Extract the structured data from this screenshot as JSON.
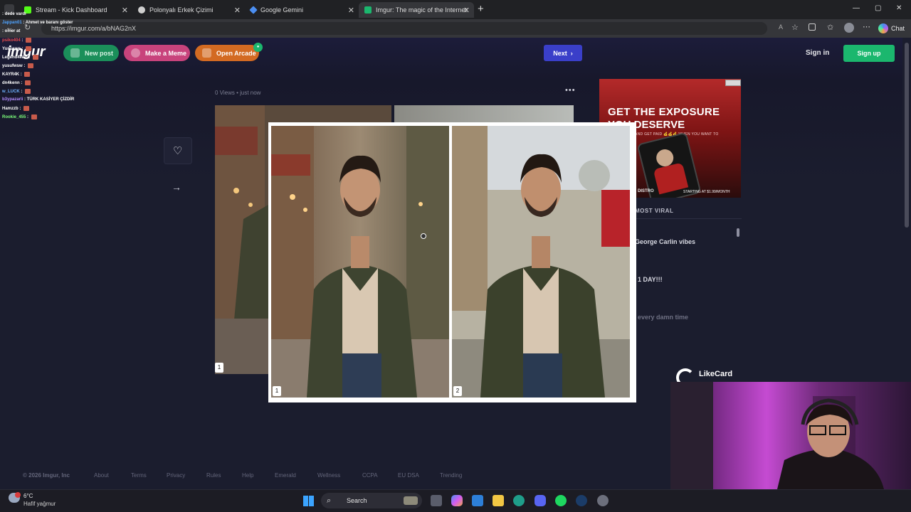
{
  "browser": {
    "tabs": [
      {
        "label": "Stream - Kick Dashboard",
        "icon_color": "#53fc18"
      },
      {
        "label": "Polonyalı Erkek Çizimi",
        "icon_color": "#cccccc"
      },
      {
        "label": "Google Gemini",
        "icon_color": "#4b8ef1"
      },
      {
        "label": "Imgur: The magic of the Internet",
        "icon_color": "#1bb76e"
      }
    ],
    "url": "https://imgur.com/a/bNAG2nX",
    "chat_button": "Chat"
  },
  "imgur": {
    "logo": "imgur",
    "new_post": "New post",
    "make_meme": "Make a Meme",
    "open_arcade": "Open Arcade",
    "next": "Next",
    "sign_in": "Sign in",
    "sign_up": "Sign up",
    "meta": "0 Views • just now",
    "more_menu": "•••",
    "like_icon": "♡",
    "share_icon": "→",
    "image_number": "1"
  },
  "ad": {
    "headline1": "GET THE EXPOSURE",
    "headline2": "YOU DESERVE",
    "sub": "AND GET PAID 💰💰💰 WHEN YOU WANT TO",
    "brand": "DISTRO",
    "price": "STARTING AT $1.99/MONTH"
  },
  "sidebar": {
    "title": "MOST VIRAL",
    "items": [
      "George Carlin vibes",
      "1 DAY!!!",
      "every damn time"
    ]
  },
  "lightbox": {
    "photos": [
      {
        "number": "1"
      },
      {
        "number": "2"
      }
    ]
  },
  "chat": [
    {
      "user": "",
      "msg": "dede vardı",
      "color": "#9b9b9b"
    },
    {
      "user": "Jappan01",
      "msg": "Ahmet ve baranı göster",
      "color": "#4ea3ff"
    },
    {
      "user": "",
      "msg": "omer at",
      "color": "#e06060"
    },
    {
      "user": "psiko404",
      "msg": "",
      "color": "#e84d4d"
    },
    {
      "user": "Yunuswe",
      "msg": "",
      "color": "#ffffff"
    },
    {
      "user": "Legend4Win",
      "msg": "",
      "color": "#ffffff"
    },
    {
      "user": "yusufwsw",
      "msg": "",
      "color": "#ffffff"
    },
    {
      "user": "KAYR4K",
      "msg": "",
      "color": "#ffffff"
    },
    {
      "user": "dn4kenn",
      "msg": "",
      "color": "#ffffff"
    },
    {
      "user": "w_LUCK",
      "msg": "",
      "color": "#6fb2ff"
    },
    {
      "user": "b3ypazarli",
      "msg": "TÜRK KASİYER ÇİZDİR",
      "color": "#b38cff"
    },
    {
      "user": "Hamzzb",
      "msg": "",
      "color": "#ffffff"
    },
    {
      "user": "Rookie_455",
      "msg": "",
      "color": "#7cff7c"
    }
  ],
  "footer": {
    "copyright": "© 2026 Imgur, Inc",
    "links": [
      "About",
      "Terms",
      "Privacy",
      "Rules",
      "Help",
      "Emerald",
      "Wellness",
      "CCPA",
      "EU DSA",
      "Trending"
    ]
  },
  "overlay": {
    "likecard": "LikeCard"
  },
  "taskbar": {
    "temperature": "6°C",
    "weather": "Hafif yağmur",
    "search": "Search"
  },
  "colors": {
    "green": "#1bb76e",
    "pink": "#e44c8b",
    "orange": "#e97c2c",
    "next_blue": "#3a3fc9"
  }
}
